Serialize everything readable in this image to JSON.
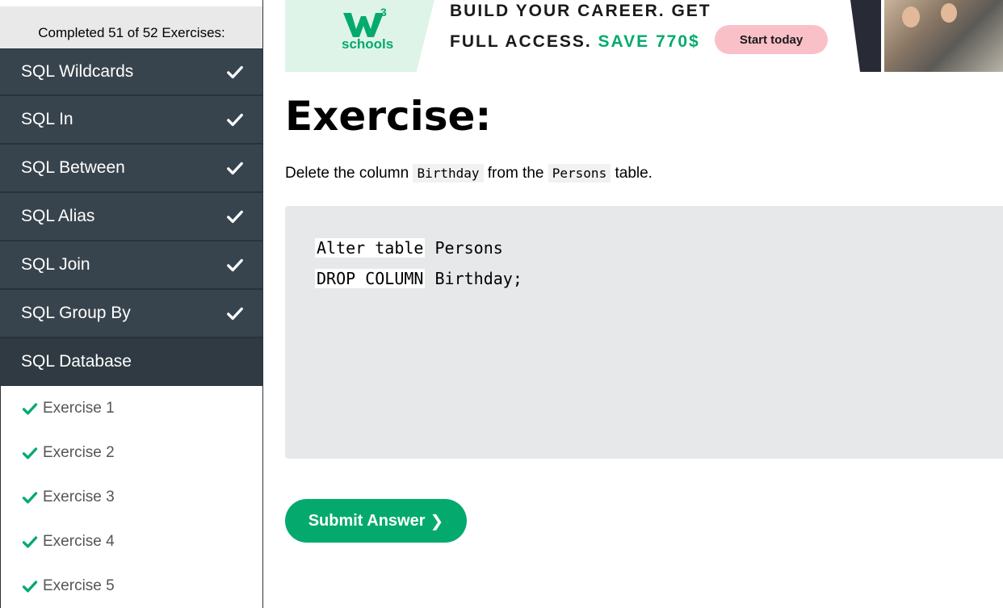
{
  "sidebar": {
    "progress_text": "Completed 51 of 52 Exercises:",
    "topics": [
      {
        "label": "SQL Wildcards",
        "completed": true
      },
      {
        "label": "SQL In",
        "completed": true
      },
      {
        "label": "SQL Between",
        "completed": true
      },
      {
        "label": "SQL Alias",
        "completed": true
      },
      {
        "label": "SQL Join",
        "completed": true
      },
      {
        "label": "SQL Group By",
        "completed": true
      },
      {
        "label": "SQL Database",
        "completed": false
      }
    ],
    "exercises": [
      {
        "label": "Exercise 1",
        "completed": true
      },
      {
        "label": "Exercise 2",
        "completed": true
      },
      {
        "label": "Exercise 3",
        "completed": true
      },
      {
        "label": "Exercise 4",
        "completed": true
      },
      {
        "label": "Exercise 5",
        "completed": true
      }
    ]
  },
  "banner": {
    "logo_sup": "3",
    "logo_text": "schools",
    "line1": "BUILD YOUR CAREER. GET",
    "line2_prefix": "FULL ACCESS.",
    "line2_highlight": "SAVE 770$",
    "cta_label": "Start today"
  },
  "main": {
    "title": "Exercise:",
    "instruction": {
      "part1": "Delete the column",
      "code1": "Birthday",
      "part2": "from the",
      "code2": "Persons",
      "part3": "table."
    },
    "code": {
      "line1_input": "Alter table",
      "line1_rest": " Persons",
      "line2_input": "DROP COLUMN",
      "line2_rest": " Birthday;"
    },
    "submit_label": "Submit Answer",
    "submit_arrow": "❯"
  },
  "colors": {
    "accent": "#04aa6d",
    "sidebar_dark": "#38444d",
    "code_bg": "#e7e8ea",
    "cta_pink": "#f9c0c8"
  },
  "icons": {
    "topic_check": "check-icon",
    "exercise_check": "check-icon-green"
  }
}
